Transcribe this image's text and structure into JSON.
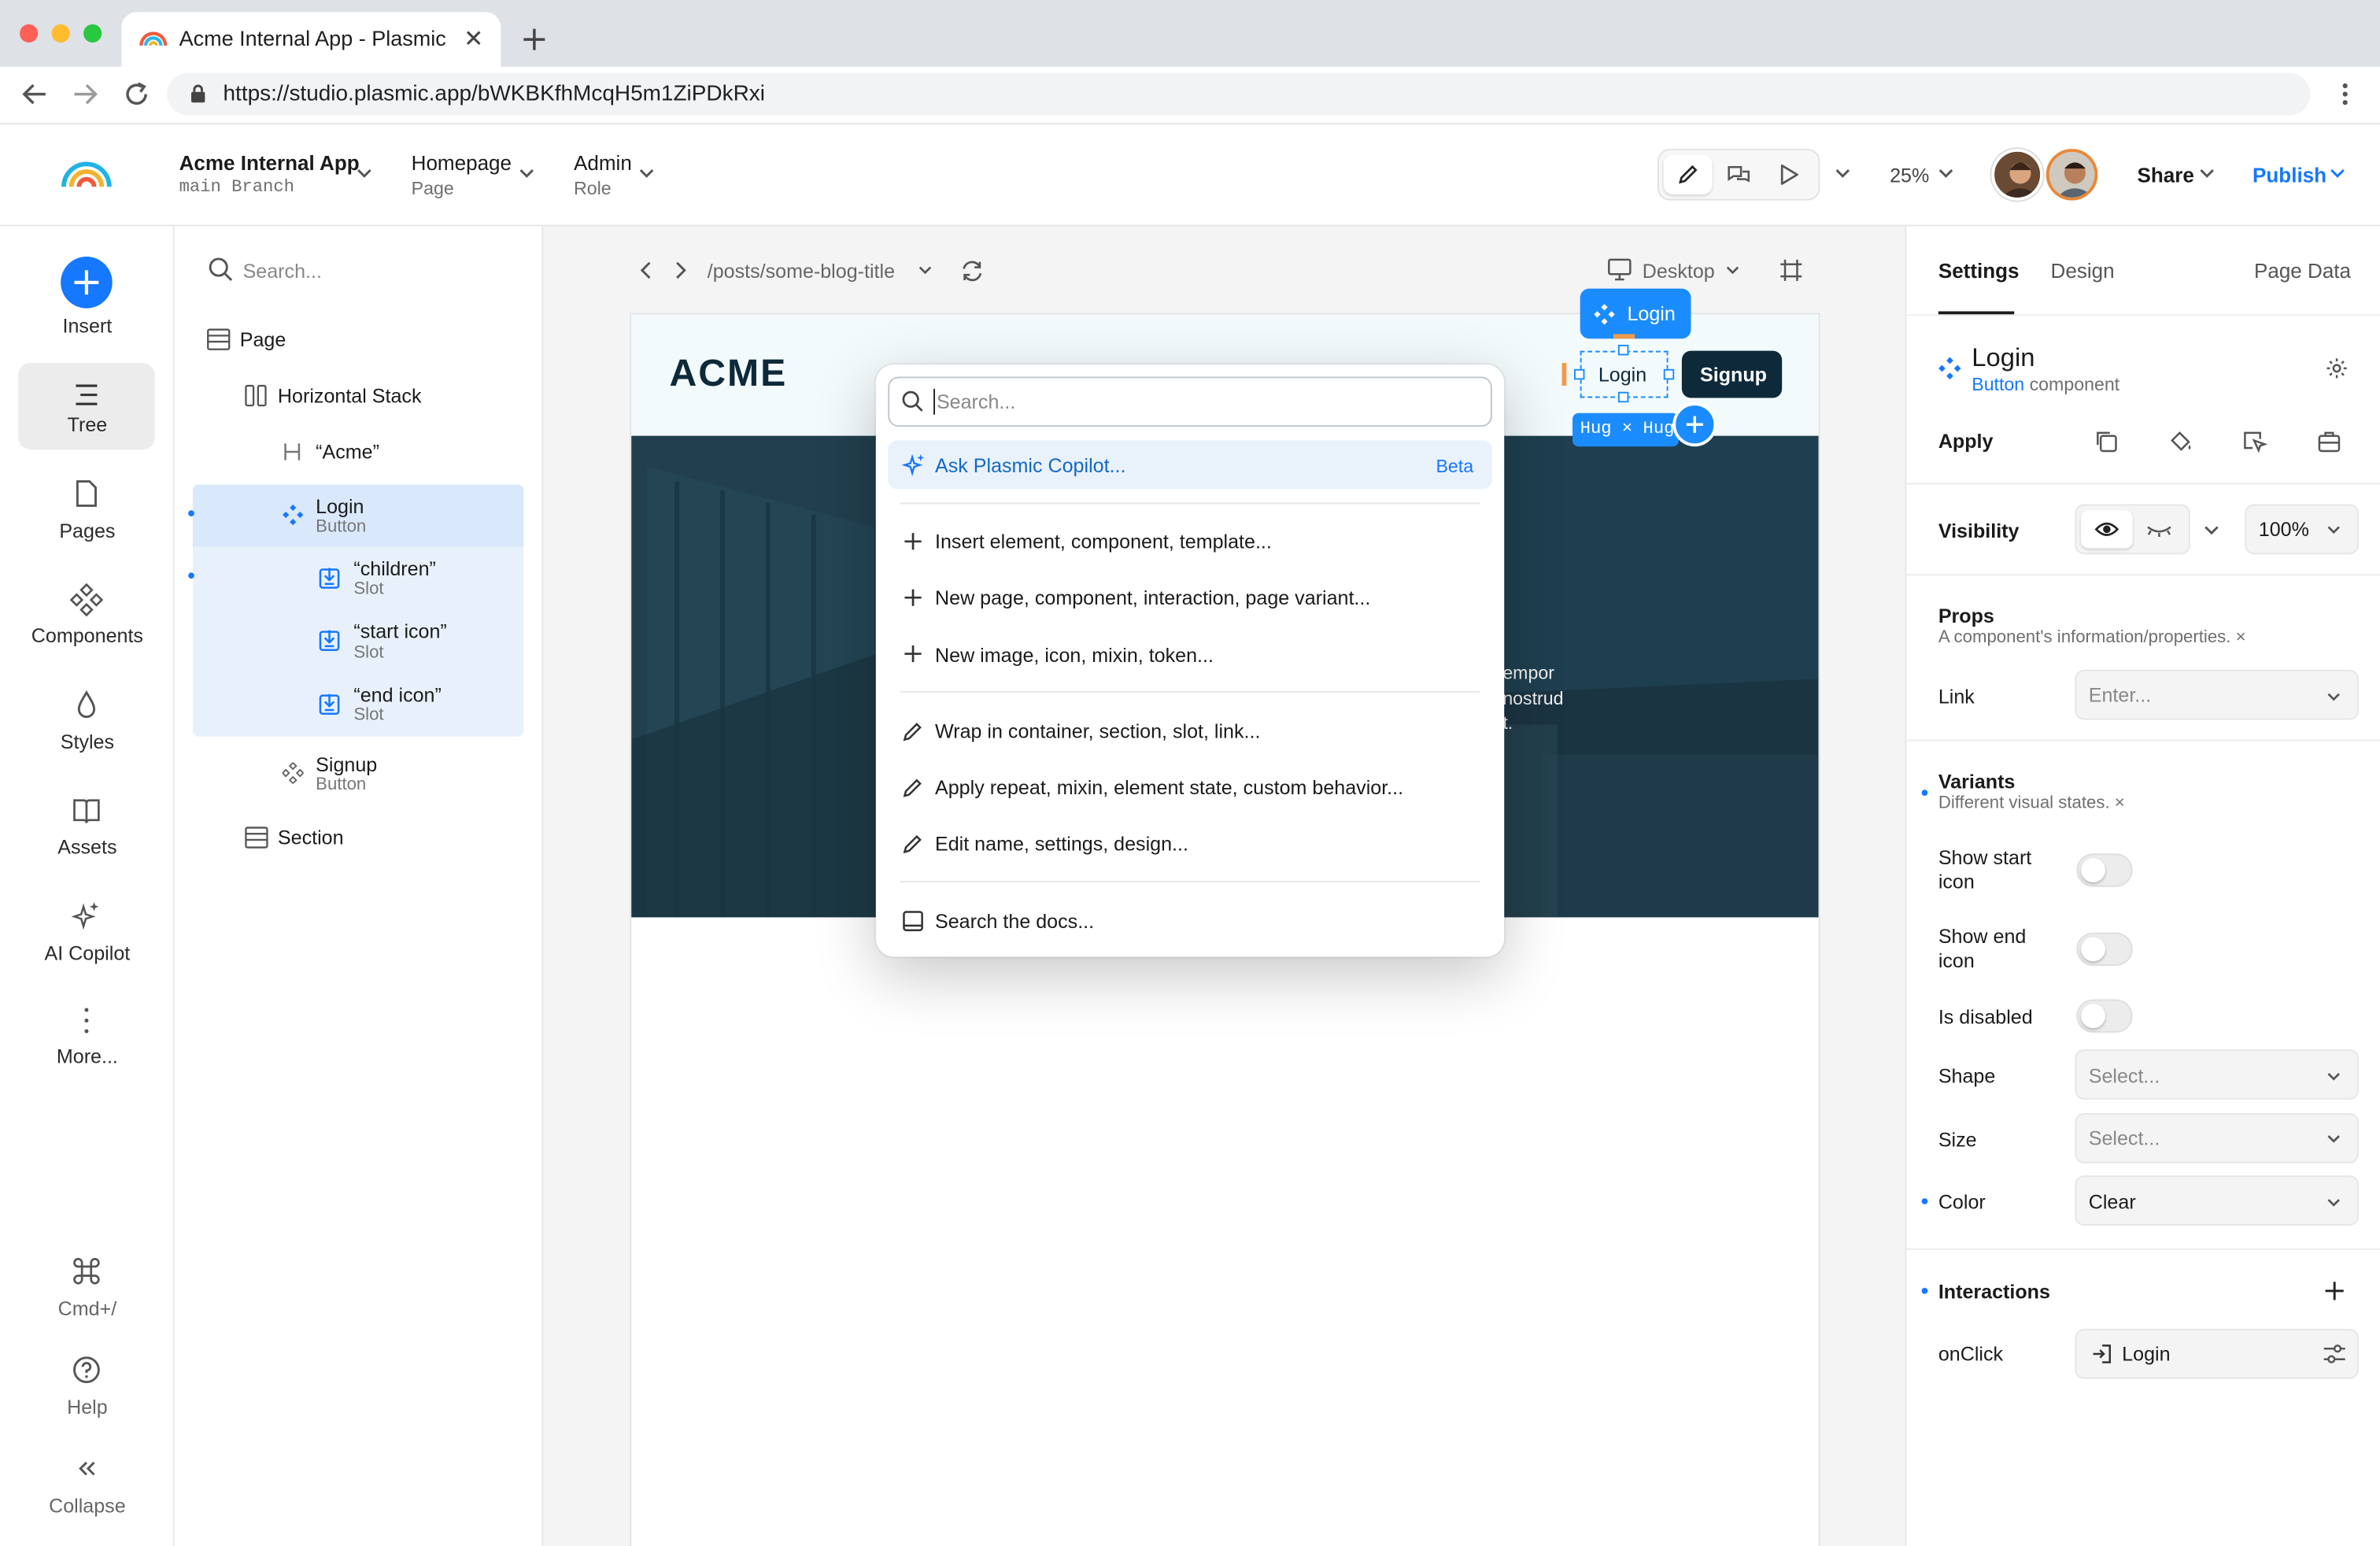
{
  "browser": {
    "tab_title": "Acme Internal App - Plasmic",
    "url": "https://studio.plasmic.app/bWKBKfhMcqH5m1ZiPDkRxi"
  },
  "toolbar": {
    "project_name": "Acme Internal App",
    "branch": "main Branch",
    "page_name": "Homepage",
    "page_label": "Page",
    "role_name": "Admin",
    "role_label": "Role",
    "zoom": "25%",
    "share_label": "Share",
    "publish_label": "Publish"
  },
  "leftnav": {
    "items": [
      {
        "label": "Insert",
        "icon": "plus-circle-icon"
      },
      {
        "label": "Tree",
        "icon": "tree-icon"
      },
      {
        "label": "Pages",
        "icon": "file-icon"
      },
      {
        "label": "Components",
        "icon": "components-icon"
      },
      {
        "label": "Styles",
        "icon": "droplet-icon"
      },
      {
        "label": "Assets",
        "icon": "book-icon"
      },
      {
        "label": "AI Copilot",
        "icon": "sparkles-icon"
      },
      {
        "label": "More...",
        "icon": "more-vertical-icon"
      },
      {
        "label": "Cmd+/",
        "icon": "command-icon"
      },
      {
        "label": "Help",
        "icon": "help-icon"
      },
      {
        "label": "Collapse",
        "icon": "collapse-icon"
      }
    ]
  },
  "tree": {
    "search_placeholder": "Search...",
    "nodes": [
      {
        "label": "Page",
        "sub": "",
        "icon": "section-icon"
      },
      {
        "label": "Horizontal Stack",
        "sub": "",
        "icon": "hstack-icon"
      },
      {
        "label": "“Acme”",
        "sub": "",
        "icon": "heading-icon"
      },
      {
        "label": "Login",
        "sub": "Button",
        "icon": "component-icon"
      },
      {
        "label": "“children”",
        "sub": "Slot",
        "icon": "slot-icon"
      },
      {
        "label": "“start icon”",
        "sub": "Slot",
        "icon": "slot-icon"
      },
      {
        "label": "“end icon”",
        "sub": "Slot",
        "icon": "slot-icon"
      },
      {
        "label": "Signup",
        "sub": "Button",
        "icon": "component-icon"
      },
      {
        "label": "Section",
        "sub": "",
        "icon": "section-icon"
      }
    ]
  },
  "canvas": {
    "route": "/posts/some-blog-title",
    "device": "Desktop",
    "brand": "ACME",
    "login_label": "Login",
    "signup_label": "Signup",
    "selection_tag": "Login",
    "size_badge": "Hug × Hug",
    "hero_text_lines": [
      "empor",
      "nostrud",
      "t."
    ]
  },
  "palette": {
    "search_placeholder": "Search...",
    "copilot_label": "Ask Plasmic Copilot...",
    "copilot_badge": "Beta",
    "groups": [
      [
        "Insert element, component, template...",
        "New page, component, interaction, page variant...",
        "New image, icon, mixin, token..."
      ],
      [
        "Wrap in container, section, slot, link...",
        "Apply repeat, mixin, element state, custom behavior...",
        "Edit name, settings, design..."
      ],
      [
        "Search the docs..."
      ]
    ]
  },
  "rightpanel": {
    "tabs": [
      "Settings",
      "Design",
      "Page Data"
    ],
    "component_name": "Login",
    "component_type_link": "Button",
    "component_type_rest": " component",
    "apply_label": "Apply",
    "visibility_label": "Visibility",
    "opacity": "100%",
    "props_title": "Props",
    "props_desc": "A component's information/properties. ×",
    "link_label": "Link",
    "link_placeholder": "Enter...",
    "variants_title": "Variants",
    "variants_desc": "Different visual states. ×",
    "show_start_icon": "Show start icon",
    "show_end_icon": "Show end icon",
    "is_disabled": "Is disabled",
    "shape_label": "Shape",
    "size_label": "Size",
    "color_label": "Color",
    "select_placeholder": "Select...",
    "color_value": "Clear",
    "interactions_title": "Interactions",
    "onclick_label": "onClick",
    "onclick_value": "Login"
  },
  "colors": {
    "accent": "#1677ff",
    "dark_button": "#0e2a3a",
    "hero": "#1d3f50"
  }
}
